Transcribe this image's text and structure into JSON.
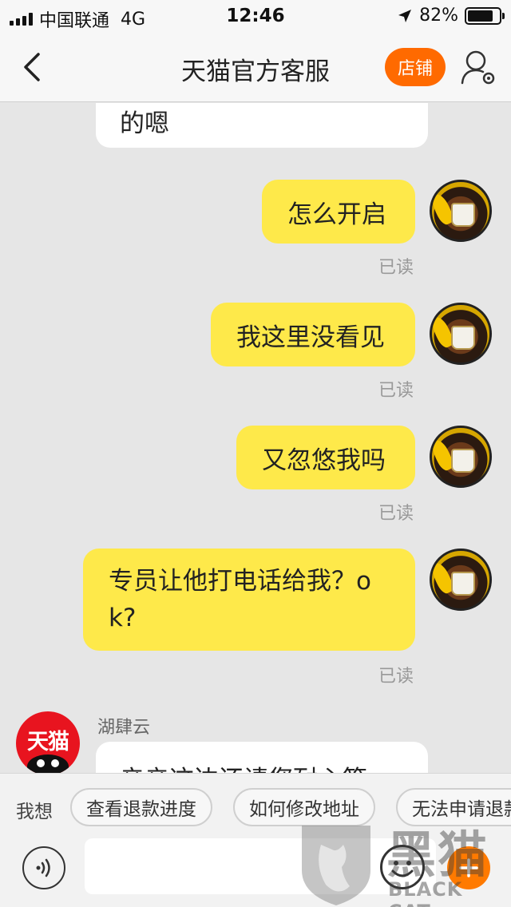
{
  "status_bar": {
    "carrier": "中国联通",
    "network": "4G",
    "time": "12:46",
    "battery_pct": "82%",
    "battery_level": 0.82,
    "location_icon": "location-arrow-icon"
  },
  "header": {
    "title": "天猫官方客服",
    "shop_button": "店铺",
    "back_icon": "chevron-left-icon",
    "user_icon": "user-settings-icon"
  },
  "messages": [
    {
      "side": "in",
      "text": "的嗯"
    },
    {
      "side": "out",
      "text": "怎么开启",
      "status": "已读"
    },
    {
      "side": "out",
      "text": "我这里没看见",
      "status": "已读"
    },
    {
      "side": "out",
      "text": "又忽悠我吗",
      "status": "已读"
    },
    {
      "side": "out",
      "text_line1": "专员让他打电话给我？o",
      "text_line2": "k?",
      "status": "已读"
    },
    {
      "side": "in",
      "sender": "湖肆云",
      "avatar_text": "天猫",
      "text": "亲亲这边还请您耐心等"
    }
  ],
  "quick_phrases": {
    "label": "我想",
    "items": [
      "查看退款进度",
      "如何修改地址",
      "无法申请退款"
    ]
  },
  "input_bar": {
    "placeholder": "",
    "voice_icon": "voice-icon",
    "emoji_icon": "emoji-icon",
    "plus_icon": "plus-icon"
  },
  "watermark": {
    "title": "黑猫",
    "subtitle": "BLACK CAT"
  },
  "colors": {
    "outgoing_bubble": "#fee94a",
    "accent_orange": "#ff6a00",
    "tmall_red": "#e8141f",
    "background": "#e6e6e6"
  }
}
